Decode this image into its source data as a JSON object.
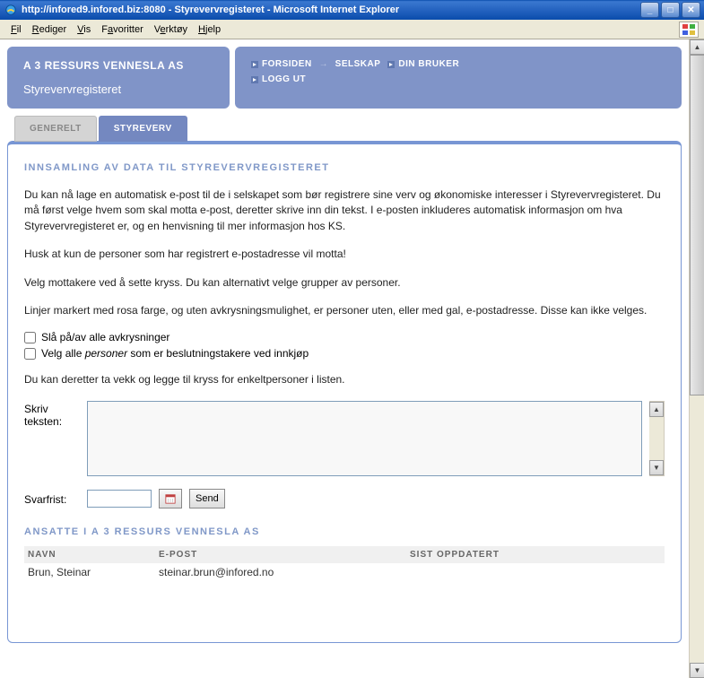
{
  "window": {
    "title": "http://infored9.infored.biz:8080 - Styrevervregisteret - Microsoft Internet Explorer"
  },
  "menubar": {
    "file": "Fil",
    "edit": "Rediger",
    "view": "Vis",
    "favorites": "Favoritter",
    "tools": "Verktøy",
    "help": "Hjelp"
  },
  "header": {
    "company": "A 3 RESSURS VENNESLA AS",
    "subtitle": "Styrevervregisteret",
    "nav": {
      "forsiden": "FORSIDEN",
      "selskap": "SELSKAP",
      "dinbruker": "DIN BRUKER",
      "loggut": "LOGG UT"
    }
  },
  "tabs": {
    "generelt": "GENERELT",
    "styreverv": "STYREVERV"
  },
  "section": {
    "title": "INNSAMLING AV DATA TIL STYREVERVREGISTERET",
    "p1": "Du kan nå lage en automatisk e-post til de i selskapet som bør registrere sine verv og økonomiske interesser i Styrevervregisteret. Du må først velge hvem som skal motta e-post, deretter skrive inn din tekst. I e-posten inkluderes automatisk informasjon om hva Styrevervregisteret er, og en henvisning til mer informasjon hos KS.",
    "p2": "Husk at kun de personer som har registrert e-postadresse vil motta!",
    "p3": "Velg mottakere ved å sette kryss. Du kan alternativt velge grupper av personer.",
    "p4": "Linjer markert med rosa farge, og uten avkrysningsmulighet, er personer uten, eller med gal, e-postadresse. Disse kan ikke velges.",
    "cb1": "Slå på/av alle avkrysninger",
    "cb2a": "Velg alle ",
    "cb2b": "personer",
    "cb2c": " som er beslutningstakere ved innkjøp",
    "p5": "Du kan deretter ta vekk og legge til kryss for enkeltpersoner i listen.",
    "label_tekst": "Skriv teksten:",
    "label_svarfrist": "Svarfrist:",
    "send": "Send"
  },
  "subsection": {
    "title": "ANSATTE I A 3 RESSURS VENNESLA AS",
    "cols": {
      "navn": "NAVN",
      "epost": "E-POST",
      "sist": "SIST OPPDATERT"
    },
    "rows": [
      {
        "navn": "Brun, Steinar",
        "epost": "steinar.brun@infored.no"
      }
    ]
  }
}
